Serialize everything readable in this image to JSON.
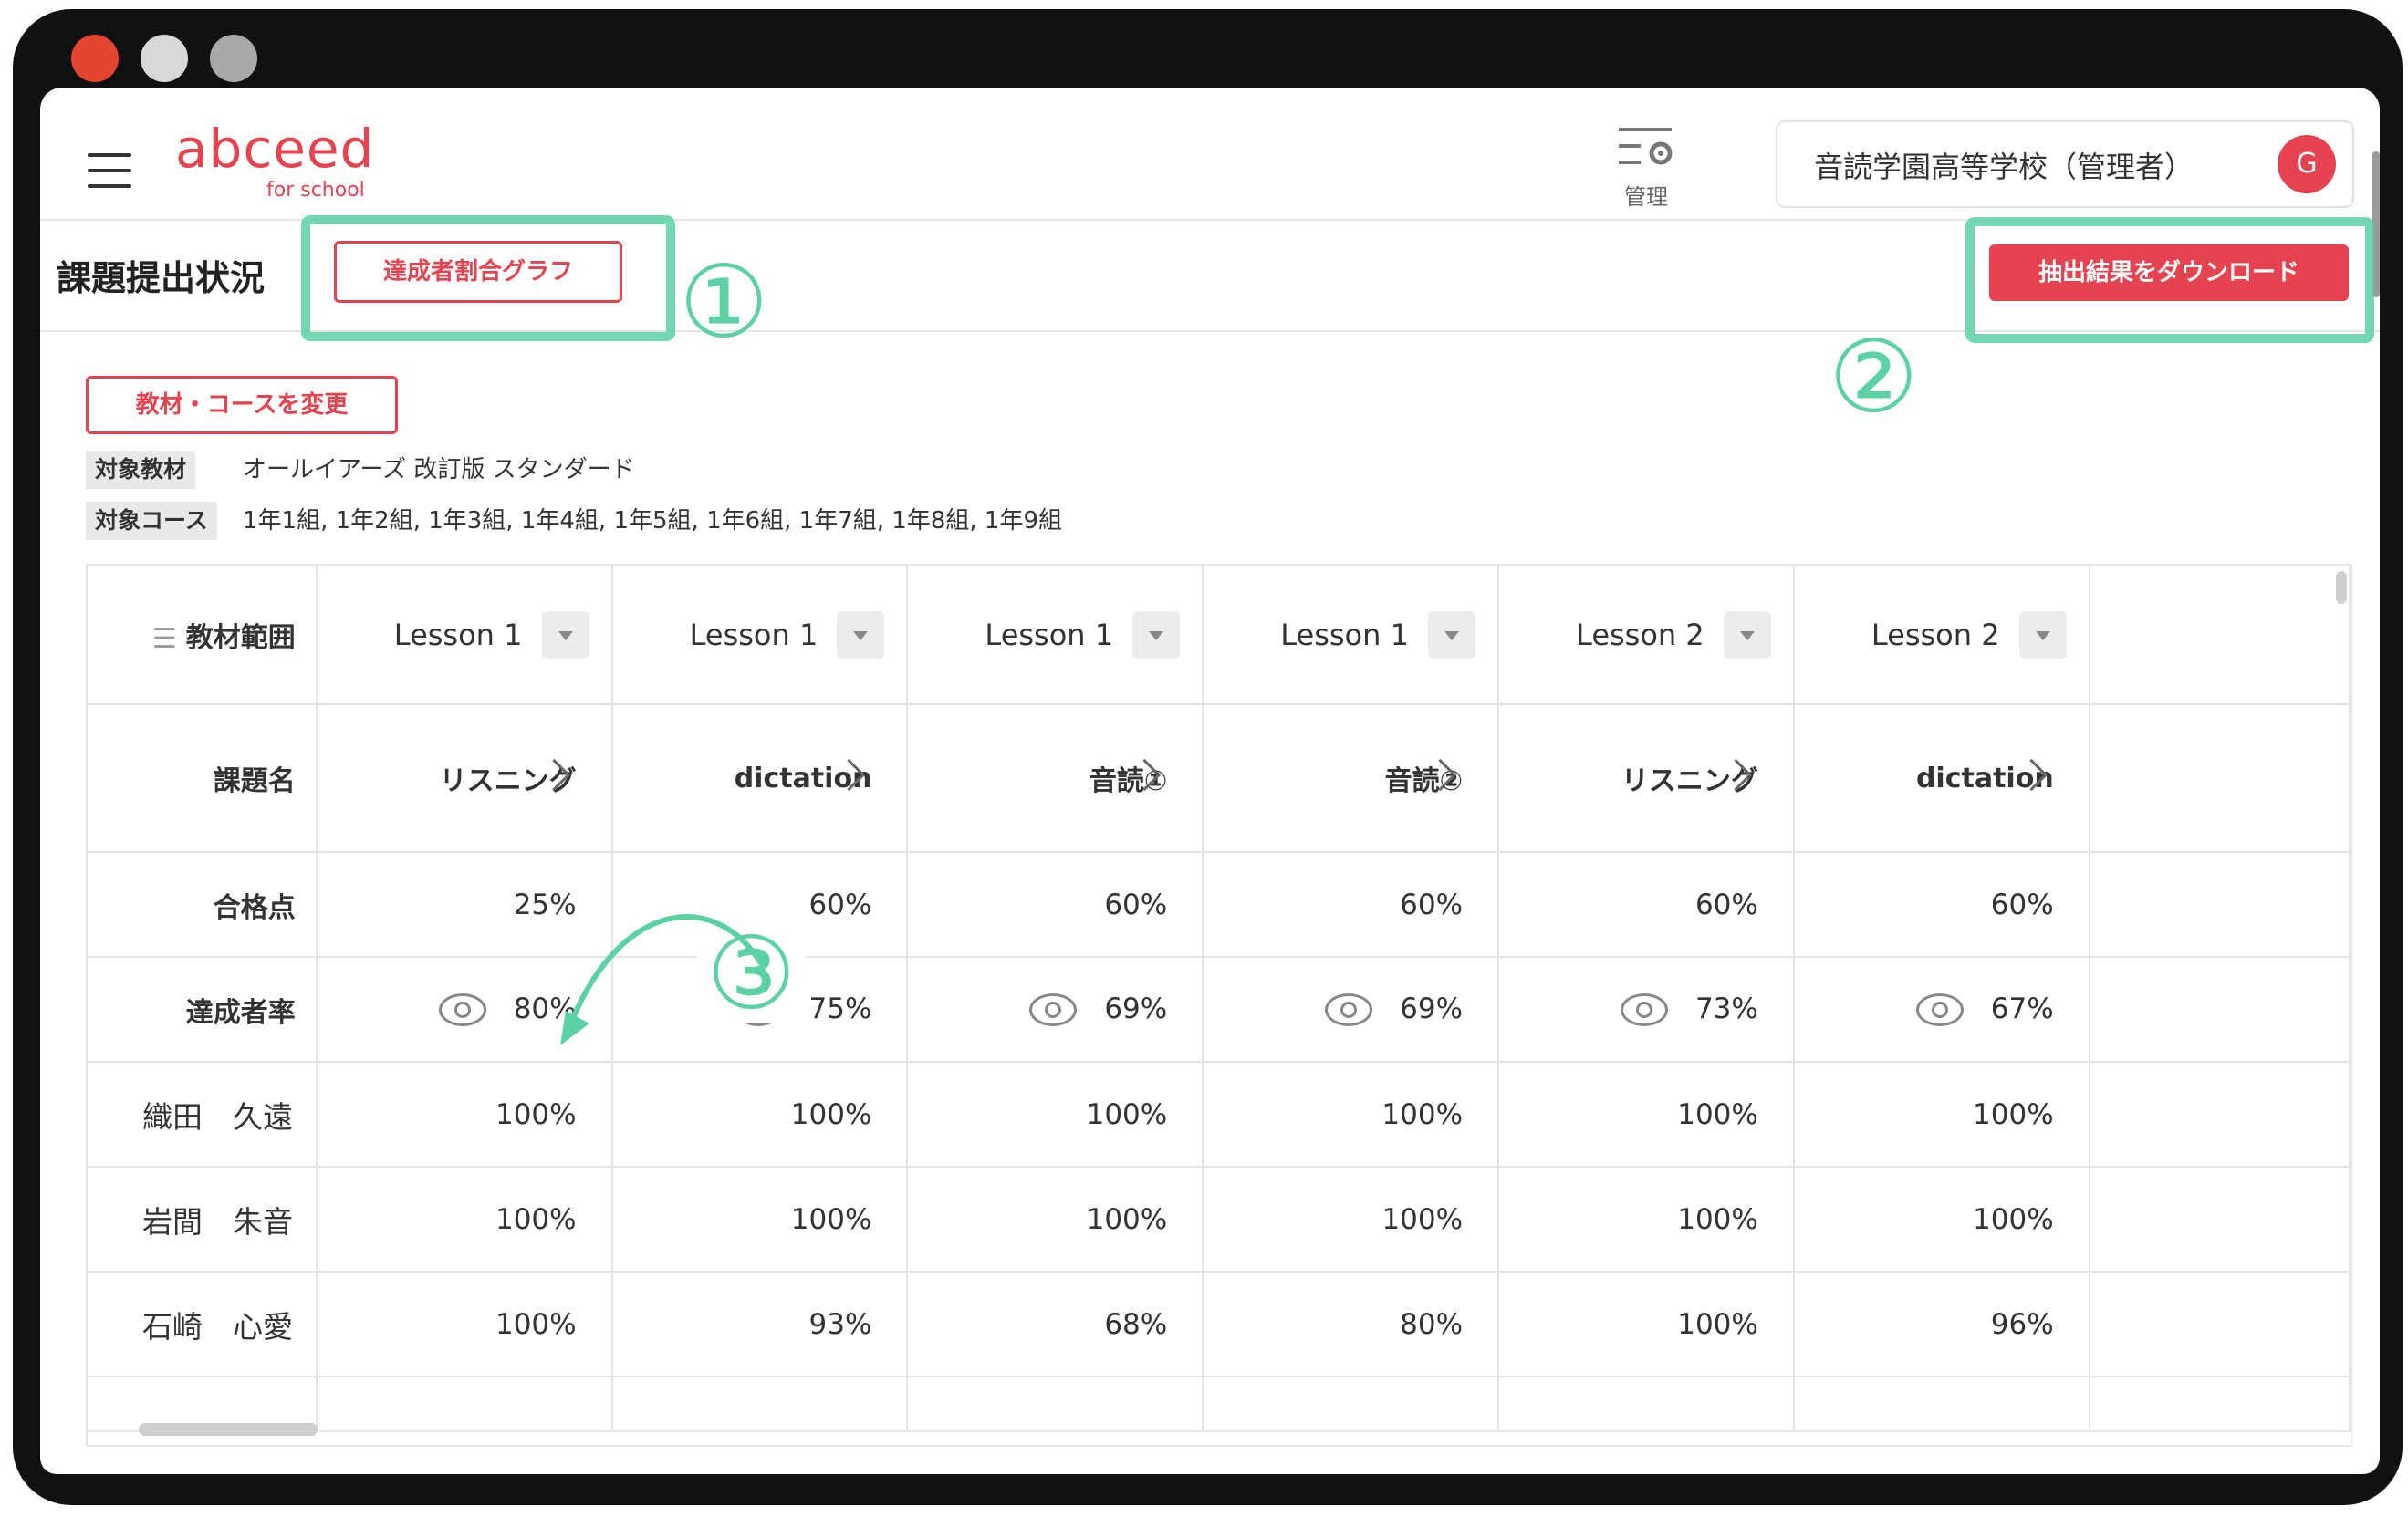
{
  "window": {
    "controls": [
      "close",
      "minimize",
      "maximize"
    ]
  },
  "header": {
    "logo_main": "abceed",
    "logo_sub": "for school",
    "admin_label": "管理",
    "user_name": "音読学園高等学校（管理者）",
    "avatar_initial": "G"
  },
  "toolbar": {
    "title": "課題提出状況",
    "graph_button": "達成者割合グラフ",
    "download_button": "抽出結果をダウンロード",
    "change_button": "教材・コースを変更"
  },
  "filters": {
    "material_tag": "対象教材",
    "material_value": "オールイアーズ 改訂版 スタンダード",
    "course_tag": "対象コース",
    "course_value": "1年1組, 1年2組, 1年3組, 1年4組, 1年5組, 1年6組, 1年7組, 1年8組, 1年9組"
  },
  "annotations": [
    "①",
    "②",
    "③"
  ],
  "table": {
    "row_labels": {
      "range": "教材範囲",
      "task": "課題名",
      "pass": "合格点",
      "rate": "達成者率"
    },
    "columns": [
      {
        "lesson": "Lesson 1",
        "task": "リスニング",
        "pass": "25%",
        "rate": "80%"
      },
      {
        "lesson": "Lesson 1",
        "task": "dictation",
        "pass": "60%",
        "rate": "75%"
      },
      {
        "lesson": "Lesson 1",
        "task": "音読①",
        "pass": "60%",
        "rate": "69%"
      },
      {
        "lesson": "Lesson 1",
        "task": "音読②",
        "pass": "60%",
        "rate": "69%"
      },
      {
        "lesson": "Lesson 2",
        "task": "リスニング",
        "pass": "60%",
        "rate": "73%"
      },
      {
        "lesson": "Lesson 2",
        "task": "dictation",
        "pass": "60%",
        "rate": "67%"
      }
    ],
    "students": [
      {
        "name": "織田　久遠",
        "scores": [
          "100%",
          "100%",
          "100%",
          "100%",
          "100%",
          "100%"
        ]
      },
      {
        "name": "岩間　朱音",
        "scores": [
          "100%",
          "100%",
          "100%",
          "100%",
          "100%",
          "100%"
        ]
      },
      {
        "name": "石崎　心愛",
        "scores": [
          "100%",
          "93%",
          "68%",
          "80%",
          "100%",
          "96%"
        ]
      }
    ]
  },
  "colors": {
    "accent": "#e5434f",
    "annotation": "#5bd1a4"
  }
}
